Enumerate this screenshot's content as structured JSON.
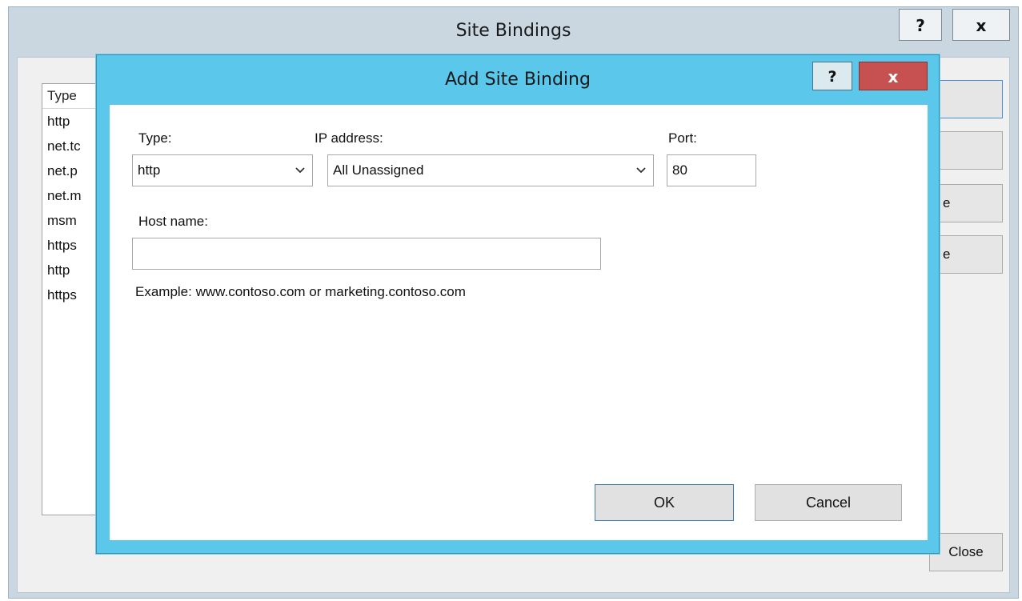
{
  "outer_window": {
    "title": "Site Bindings",
    "help_label": "?",
    "close_label": "x",
    "list": {
      "header": "Type",
      "rows": [
        "http",
        "net.tc",
        "net.p",
        "net.m",
        "msm",
        "https",
        "http",
        "https"
      ]
    },
    "buttons": {
      "add": "",
      "edit": "",
      "remove_partial": "e",
      "browse_partial": "e",
      "close": "Close"
    }
  },
  "dialog": {
    "title": "Add Site Binding",
    "help_label": "?",
    "close_label": "x",
    "type": {
      "label": "Type:",
      "value": "http"
    },
    "ip_address": {
      "label": "IP address:",
      "value": "All Unassigned"
    },
    "port": {
      "label": "Port:",
      "value": "80"
    },
    "host_name": {
      "label": "Host name:",
      "value": "",
      "placeholder": ""
    },
    "example_text": "Example: www.contoso.com or marketing.contoso.com",
    "ok_label": "OK",
    "cancel_label": "Cancel"
  },
  "icons": {
    "dropdown": "chevron-down-icon"
  },
  "colors": {
    "dialog_frame": "#5bc7ea",
    "close_button": "#c75050",
    "outer_frame": "#cad7e0"
  }
}
